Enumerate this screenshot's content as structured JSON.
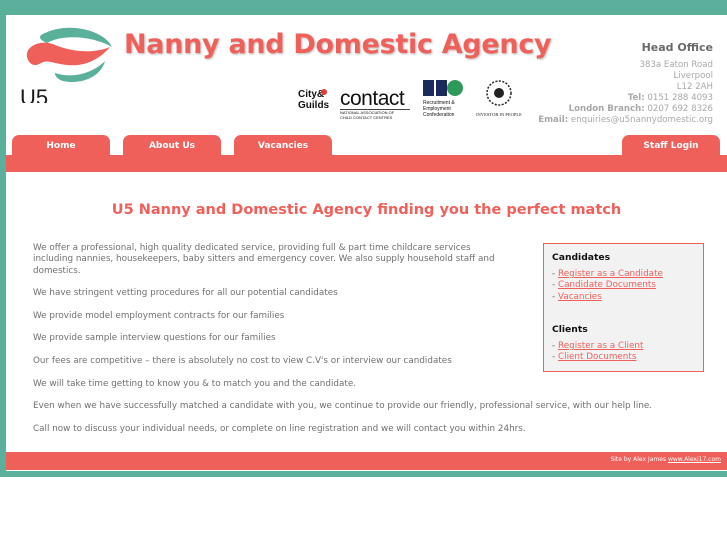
{
  "header": {
    "logo_text": "U5",
    "site_title": "Nanny and Domestic Agency",
    "contact": {
      "heading": "Head Office",
      "address_lines": [
        "383a Eaton Road",
        "Liverpool",
        "L12 2AH"
      ],
      "tel_label": "Tel:",
      "tel_value": "0151 288 4093",
      "london_label": "London Branch:",
      "london_value": "0207 692 8326",
      "email_label": "Email:",
      "email_value": "enquiries@u5nannydomestic.org"
    },
    "accreditations": {
      "city_guilds": [
        "City&",
        "Guilds"
      ],
      "contact_logo": "contact",
      "contact_sub": [
        "NATIONAL ASSOCIATION OF",
        "CHILD CONTACT CENTRES"
      ],
      "rec_sub": [
        "Recruitment &",
        "Employment",
        "Confederation"
      ],
      "iip_sub": "INVESTOR IN PEOPLE"
    }
  },
  "nav": {
    "home": "Home",
    "about": "About Us",
    "vacancies": "Vacancies",
    "staff_login": "Staff Login"
  },
  "main": {
    "headline": "U5 Nanny and Domestic Agency finding you the perfect match",
    "paragraphs": [
      "We offer a professional, high quality dedicated service, providing full & part time childcare services including nannies, housekeepers, baby sitters and emergency cover. We also supply household staff and domestics.",
      "We have stringent vetting procedures for all our potential candidates",
      "We provide model employment contracts for our families",
      "We provide sample interview questions for our families",
      "Our fees are competitive – there is absolutely no cost to view C.V's or interview our candidates",
      "We will take time getting to know you & to match you and the candidate.",
      "Even when we have successfully matched a candidate with you, we continue to provide our friendly, professional service, with our help line.",
      "Call now to discuss your individual needs, or complete on line registration and we will contact you within 24hrs."
    ]
  },
  "sidebar": {
    "candidates_heading": "Candidates",
    "candidates_links": [
      "Register as a Candidate",
      "Candidate Documents",
      "Vacancies"
    ],
    "clients_heading": "Clients",
    "clients_links": [
      "Register as a Client",
      "Client Documents"
    ],
    "bullet": "- "
  },
  "footer": {
    "credit_prefix": "Site by Alex James",
    "credit_link": "www.Alexj17.com"
  },
  "colors": {
    "brand_red": "#f0605b",
    "frame_teal": "#5bb09c",
    "text_grey": "#707070"
  }
}
